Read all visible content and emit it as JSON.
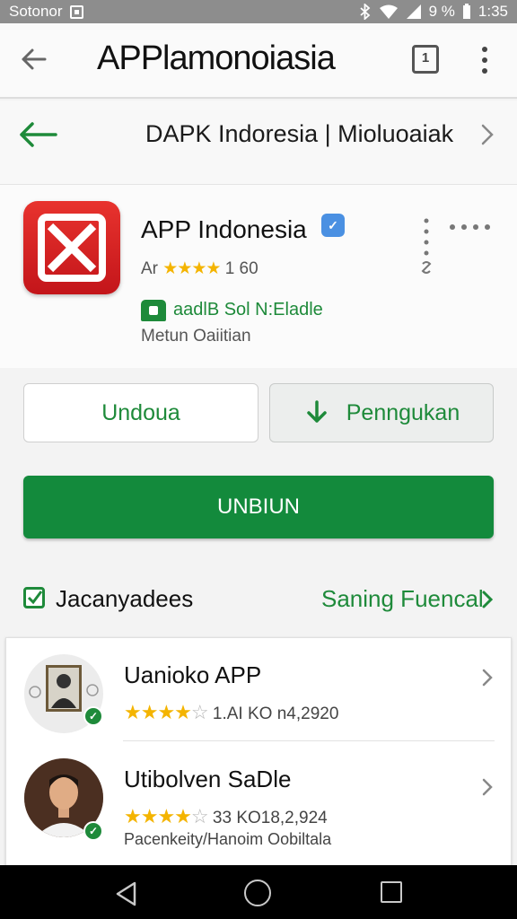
{
  "status_bar": {
    "carrier": "Sotonor",
    "time": "1:35",
    "battery": "9 %"
  },
  "app_bar": {
    "title": "APPlamonoiasia",
    "tabs_count": "1"
  },
  "breadcrumb": {
    "text": "DAPK Indoresia | Mioluoaiak"
  },
  "app": {
    "name": "APP Indonesia",
    "rating_prefix": "Ar",
    "stars": "★★★★",
    "rating_count": "1 60",
    "publisher": "aadlB Sol N:Eladle",
    "subtitle": "Metun Oaiitian"
  },
  "buttons": {
    "outline_label": "Undoua",
    "secondary_label": "Penngukan",
    "primary_label": "UNBIUN"
  },
  "section": {
    "title": "Jacanyadees",
    "link": "Saning Fuencal"
  },
  "list": {
    "items": [
      {
        "title": "Uanioko APP",
        "stars_filled": "★★★★",
        "stars_empty": "☆",
        "meta": "1.AI KO  n4,2920"
      },
      {
        "title": "Utibolven SaDle",
        "stars_filled": "★★★★",
        "stars_empty": "☆",
        "meta": "33 KO18,2,924"
      }
    ],
    "description": "Pacenkeity/Hanoim Oobiltala"
  },
  "colors": {
    "accent_green": "#1e8a3a",
    "primary_button": "#138a3c",
    "app_icon_red": "#d92026",
    "star_yellow": "#f4b400"
  }
}
